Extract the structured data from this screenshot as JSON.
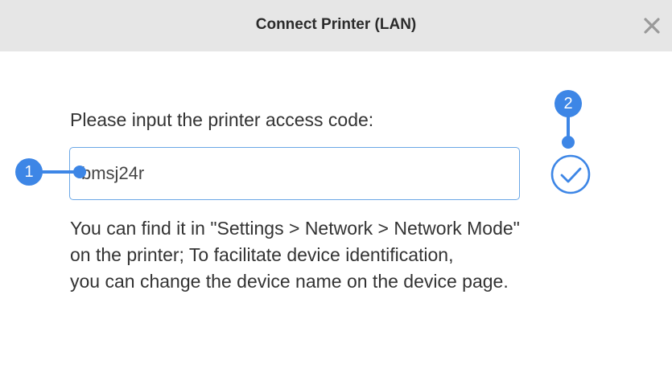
{
  "dialog": {
    "title": "Connect Printer (LAN)",
    "close_icon": "close-icon",
    "prompt": "Please input the printer access code:",
    "access_code_value": "bmsj24r",
    "confirm_icon": "check-circle-icon",
    "help_lines": [
      "You can find it in \"Settings > Network > Network Mode\"",
      "on the printer; To facilitate device identification,",
      "you can change the device name on the device page."
    ]
  },
  "annotations": [
    {
      "label": "1"
    },
    {
      "label": "2"
    }
  ],
  "colors": {
    "accent": "#3d86e6",
    "input_border": "#6aa7e6",
    "titlebar": "#e6e6e6",
    "close_icon": "#9a9a9a"
  }
}
